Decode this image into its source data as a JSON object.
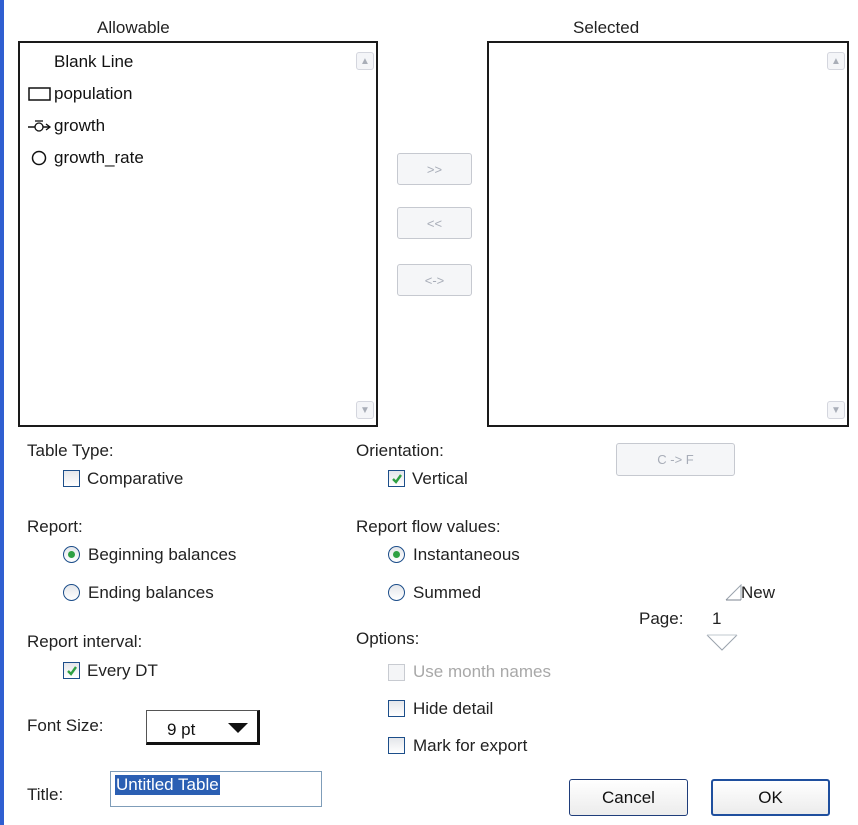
{
  "headers": {
    "allowable": "Allowable",
    "selected": "Selected"
  },
  "allowable_items": [
    {
      "label": "Blank Line",
      "icon": "none"
    },
    {
      "label": "population",
      "icon": "stock-icon"
    },
    {
      "label": "growth",
      "icon": "flow-icon"
    },
    {
      "label": "growth_rate",
      "icon": "converter-icon"
    }
  ],
  "transfer_buttons": {
    "add": ">>",
    "remove": "<<",
    "swap": "<->"
  },
  "cf_button": "C -> F",
  "table_type": {
    "label": "Table Type:",
    "comparative": "Comparative",
    "comparative_checked": false
  },
  "orientation": {
    "label": "Orientation:",
    "vertical": "Vertical",
    "vertical_checked": true
  },
  "report": {
    "label": "Report:",
    "beginning": "Beginning balances",
    "ending": "Ending balances",
    "selected": "beginning"
  },
  "report_flow": {
    "label": "Report flow values:",
    "instantaneous": "Instantaneous",
    "summed": "Summed",
    "selected": "instantaneous"
  },
  "page": {
    "label": "Page:",
    "value": "1",
    "new_label": "New"
  },
  "report_interval": {
    "label": "Report interval:",
    "every_dt": "Every DT",
    "every_dt_checked": true
  },
  "options": {
    "label": "Options:",
    "use_month_names": "Use month names",
    "hide_detail": "Hide detail",
    "mark_for_export": "Mark for export"
  },
  "font_size": {
    "label": "Font Size:",
    "value": "9 pt"
  },
  "title": {
    "label": "Title:",
    "value": "Untitled Table"
  },
  "buttons": {
    "cancel": "Cancel",
    "ok": "OK"
  },
  "colors": {
    "accent": "#2f5fd1",
    "radio_dot": "#2ea043",
    "selection": "#2b5fb3"
  }
}
